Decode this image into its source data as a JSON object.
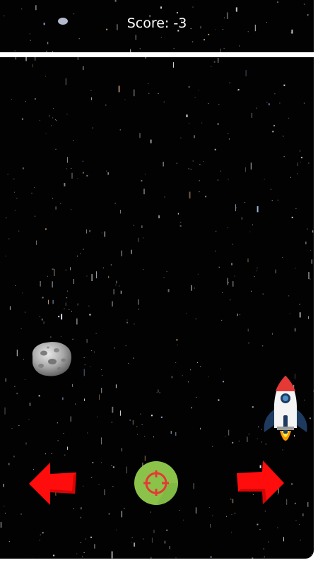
{
  "hud": {
    "score_label": "Score:",
    "score_value": "-3",
    "score_text": "Score: -3"
  },
  "colors": {
    "background": "#020203",
    "hud_line": "#ffffff",
    "arrow": "#ff0d0d",
    "fire_button_fill": "#8bc34a",
    "fire_button_mark": "#e53935",
    "rocket_body": "#f2f2f2",
    "rocket_nose": "#e53935",
    "rocket_fins": "#1f3a5f",
    "asteroid": "#b0b0b0"
  },
  "controls": {
    "left": {
      "icon": "left-arrow-icon"
    },
    "fire": {
      "icon": "crosshair-icon"
    },
    "right": {
      "icon": "right-arrow-icon"
    }
  },
  "sprites": {
    "player": "rocket-icon",
    "obstacle": "asteroid-icon"
  }
}
